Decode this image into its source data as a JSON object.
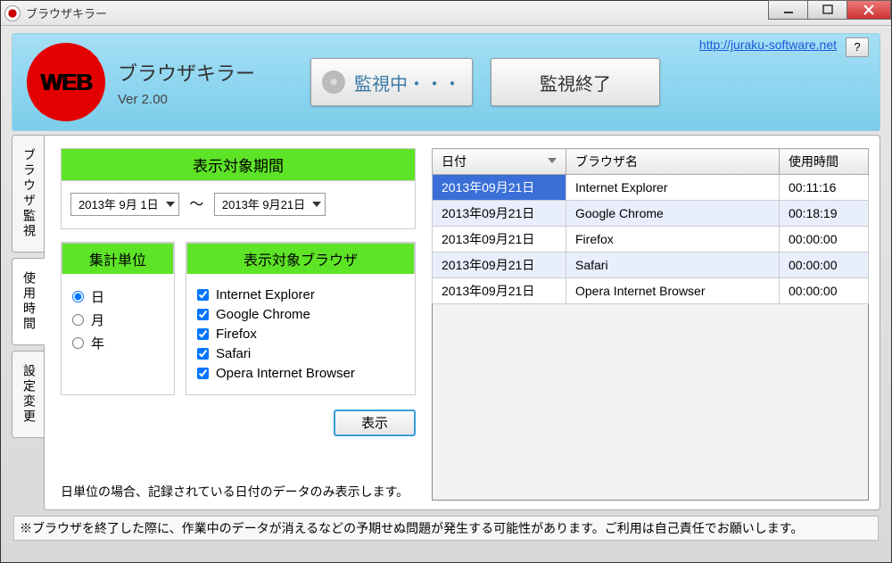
{
  "window": {
    "title": "ブラウザキラー"
  },
  "header": {
    "app_title": "ブラウザキラー",
    "version": "Ver 2.00",
    "status_label": "監視中・・・",
    "stop_label": "監視終了",
    "link_text": "http://juraku-software.net",
    "help_label": "?",
    "logo_text": "WEB"
  },
  "tabs": {
    "t0": "ブラウザ監視",
    "t1": "使用時間",
    "t2": "設定変更"
  },
  "period": {
    "header": "表示対象期間",
    "from": "2013年 9月 1日",
    "sep": "～",
    "to": "2013年 9月21日"
  },
  "unit": {
    "header": "集計単位",
    "opt_day": "日",
    "opt_month": "月",
    "opt_year": "年"
  },
  "browsers": {
    "header": "表示対象ブラウザ",
    "b0": "Internet Explorer",
    "b1": "Google Chrome",
    "b2": "Firefox",
    "b3": "Safari",
    "b4": "Opera Internet Browser"
  },
  "show_button": "表示",
  "note": "日単位の場合、記録されている日付のデータのみ表示します。",
  "table": {
    "col_date": "日付",
    "col_browser": "ブラウザ名",
    "col_time": "使用時間",
    "rows": [
      {
        "date": "2013年09月21日",
        "browser": "Internet Explorer",
        "time": "00:11:16"
      },
      {
        "date": "2013年09月21日",
        "browser": "Google Chrome",
        "time": "00:18:19"
      },
      {
        "date": "2013年09月21日",
        "browser": "Firefox",
        "time": "00:00:00"
      },
      {
        "date": "2013年09月21日",
        "browser": "Safari",
        "time": "00:00:00"
      },
      {
        "date": "2013年09月21日",
        "browser": "Opera Internet Browser",
        "time": "00:00:00"
      }
    ]
  },
  "footer": "※ブラウザを終了した際に、作業中のデータが消えるなどの予期せぬ問題が発生する可能性があります。ご利用は自己責任でお願いします。"
}
